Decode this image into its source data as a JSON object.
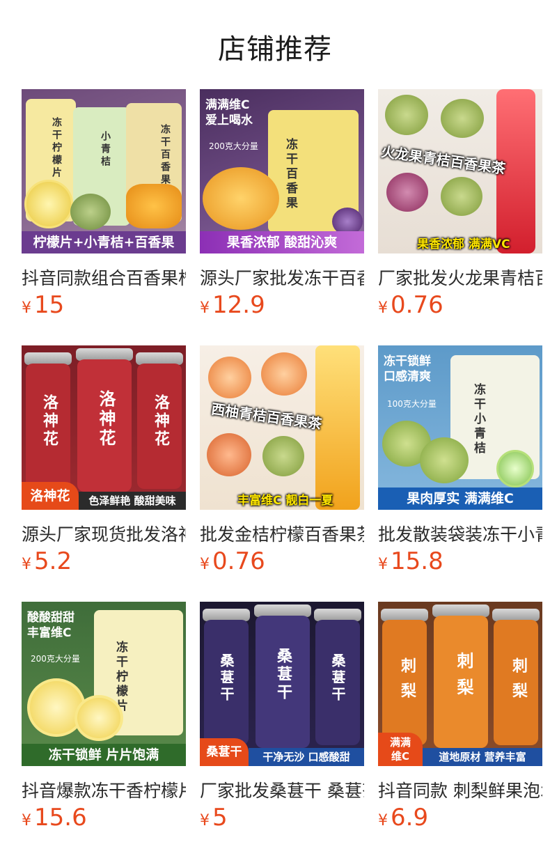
{
  "page": {
    "title": "店铺推荐"
  },
  "currency_symbol": "¥",
  "products": [
    {
      "title": "抖音同款组合百香果柠檬片小青桔",
      "price": "15",
      "image": {
        "banner": "柠檬片+小青桔+百香果",
        "labels": [
          "冻干柠檬片",
          "小青桔",
          "冻干百香果"
        ]
      }
    },
    {
      "title": "源头厂家批发冻干百香果片",
      "price": "12.9",
      "image": {
        "headline": "满满维C\n爱上喝水",
        "sub": "200克大分量",
        "bag_label": "冻干百香果",
        "banner": "果香浓郁 酸甜沁爽"
      }
    },
    {
      "title": "厂家批发火龙果青桔百香果茶",
      "price": "0.76",
      "image": {
        "overlay": "火龙果青桔百香果茶",
        "banner": "果香浓郁  满满VC"
      }
    },
    {
      "title": "源头厂家现货批发洛神花茶",
      "price": "5.2",
      "image": {
        "jar_label": "洛神花",
        "corner": "洛神花",
        "banner": "色泽鲜艳 酸甜美味"
      }
    },
    {
      "title": "批发金桔柠檬百香果茶包",
      "price": "0.76",
      "image": {
        "overlay": "西柚青桔百香果茶",
        "banner": "丰富维C 靓白一夏"
      }
    },
    {
      "title": "批发散装袋装冻干小青桔",
      "price": "15.8",
      "image": {
        "headline": "冻干锁鲜\n口感清爽",
        "sub": "100克大分量",
        "bag_label": "冻干小青桔",
        "banner": "果肉厚实 满满维C"
      }
    },
    {
      "title": "抖音爆款冻干香柠檬片",
      "price": "15.6",
      "image": {
        "headline": "酸酸甜甜\n丰富维C",
        "sub": "200克大分量",
        "bag_label": "冻干柠檬片",
        "banner": "冻干锁鲜 片片饱满"
      }
    },
    {
      "title": "厂家批发桑葚干 桑葚茶",
      "price": "5",
      "image": {
        "jar_label": "桑葚干",
        "corner": "桑葚干",
        "banner": "干净无沙 口感酸甜"
      }
    },
    {
      "title": "抖音同款 刺梨鲜果泡水",
      "price": "6.9",
      "image": {
        "jar_label": "刺梨",
        "corner": "满满\n维C",
        "banner": "道地原材 营养丰富"
      }
    }
  ]
}
